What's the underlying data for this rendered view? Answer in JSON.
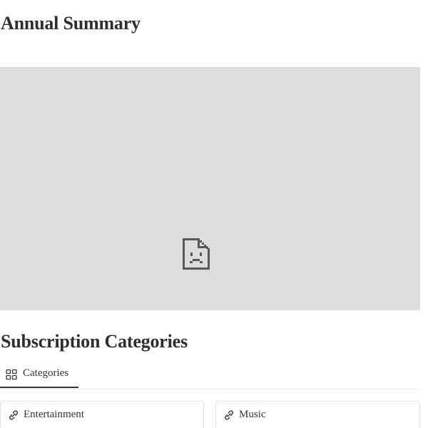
{
  "sections": {
    "annual_summary": {
      "title": "Annual Summary",
      "embed_icon": "broken-file-icon"
    },
    "subscription_categories": {
      "title": "Subscription Categories",
      "tabs": [
        {
          "label": "Categories",
          "icon": "gallery-grid-icon",
          "active": true
        }
      ],
      "cards": [
        {
          "label": "Entertainment",
          "icon": "link-icon"
        },
        {
          "label": "Music",
          "icon": "link-icon"
        }
      ]
    }
  },
  "colors": {
    "text": "#37352f",
    "embed_placeholder_bg": "#dddddd",
    "border": "#e3e2e0"
  }
}
